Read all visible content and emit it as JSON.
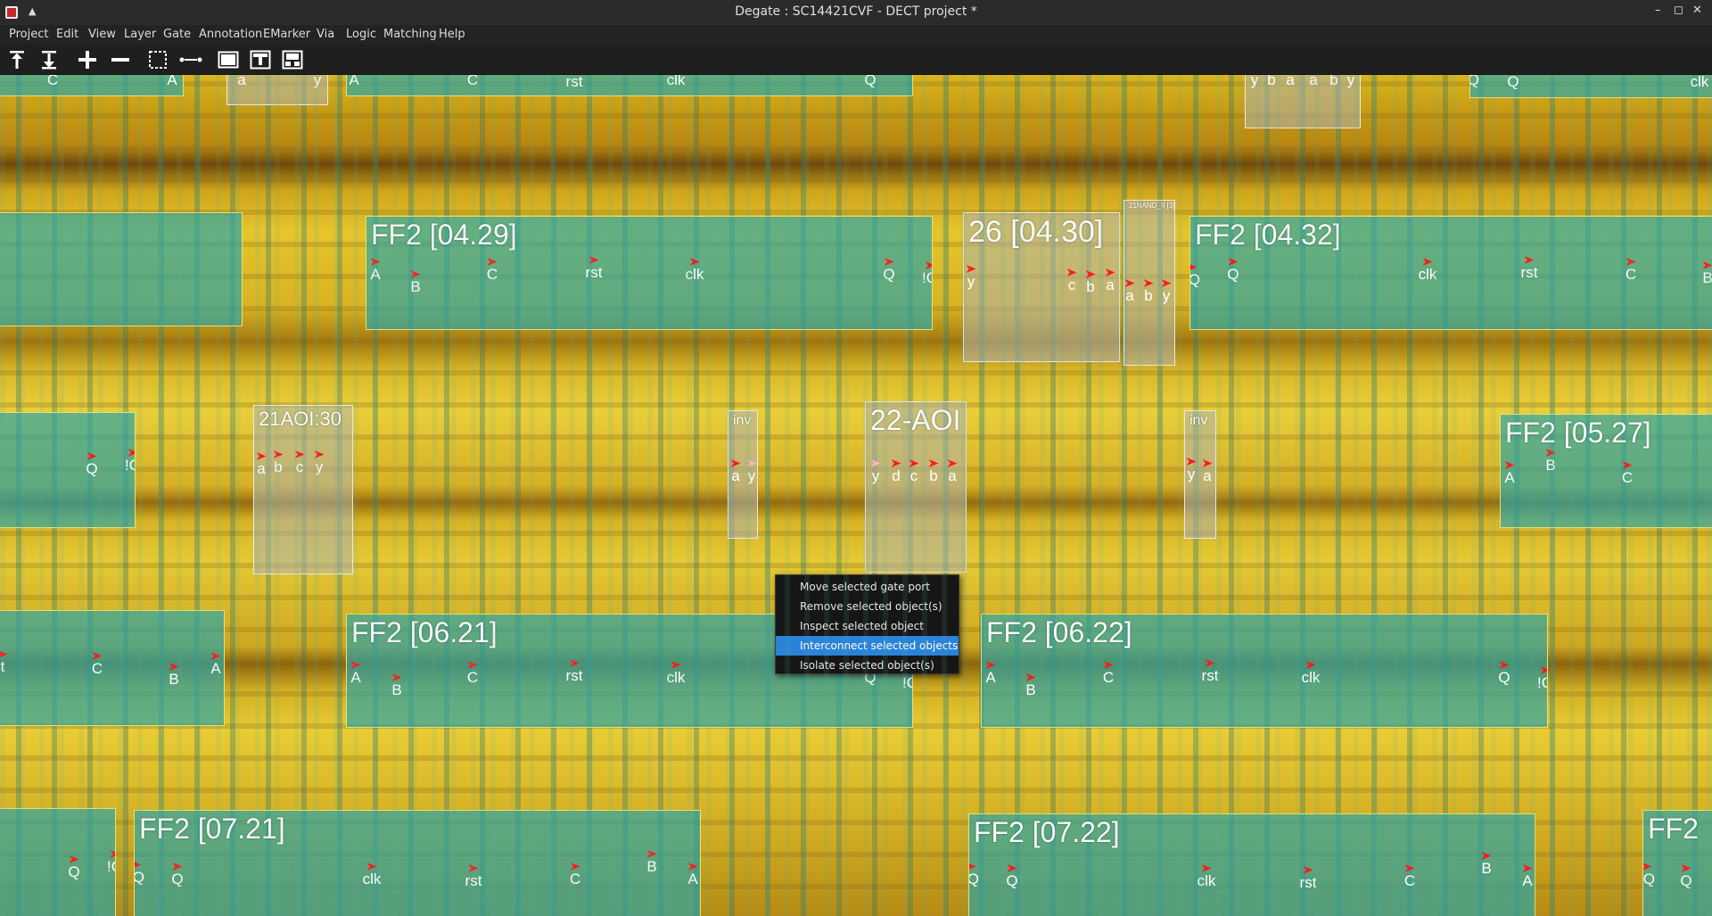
{
  "window": {
    "title": "Degate : SC14421CVF - DECT project *",
    "controls": [
      "–",
      "◻",
      "✕"
    ]
  },
  "menu": [
    "Project",
    "Edit",
    "View",
    "Layer",
    "Gate",
    "Annotation",
    "EMarker",
    "Via",
    "Logic",
    "Matching",
    "Help"
  ],
  "toolbar": [
    {
      "icon": "layer-up-icon"
    },
    {
      "icon": "layer-down-icon"
    },
    {
      "icon": "zoom-in-icon"
    },
    {
      "icon": "zoom-out-icon"
    },
    {
      "icon": "area-select-icon"
    },
    {
      "icon": "wire-tool-icon"
    },
    {
      "icon": "background-view-icon"
    },
    {
      "icon": "gate-template-icon"
    },
    {
      "icon": "gate-placement-icon"
    }
  ],
  "gates": [
    {
      "label": "",
      "style": "teal",
      "ports": [
        {
          "name": "C"
        },
        {
          "name": "A"
        }
      ]
    },
    {
      "label": "",
      "style": "gray",
      "ports": [
        {
          "name": "a"
        },
        {
          "name": "y"
        }
      ]
    },
    {
      "label": "",
      "style": "teal",
      "ports": [
        {
          "name": "A"
        },
        {
          "name": "C"
        },
        {
          "name": "rst"
        },
        {
          "name": "clk"
        },
        {
          "name": "Q"
        }
      ]
    },
    {
      "label": "",
      "style": "gray",
      "ports": [
        {
          "name": "y"
        },
        {
          "name": "b"
        },
        {
          "name": "a"
        },
        {
          "name": "a"
        },
        {
          "name": "b"
        },
        {
          "name": "y"
        }
      ]
    },
    {
      "label": "",
      "style": "teal",
      "ports": [
        {
          "name": "!Q"
        },
        {
          "name": "Q"
        },
        {
          "name": "clk"
        }
      ]
    },
    {
      "label": "",
      "style": "teal",
      "ports": []
    },
    {
      "label": "FF2 [04.29]",
      "style": "teal",
      "ports": [
        {
          "name": "A"
        },
        {
          "name": "B"
        },
        {
          "name": "C"
        },
        {
          "name": "rst"
        },
        {
          "name": "clk"
        },
        {
          "name": "Q"
        },
        {
          "name": "!Q"
        }
      ]
    },
    {
      "label": "26 [04.30]",
      "style": "gray",
      "ports": [
        {
          "name": "y"
        },
        {
          "name": "c"
        },
        {
          "name": "b"
        },
        {
          "name": "a"
        }
      ]
    },
    {
      "label": "21NAND_II [3]",
      "style": "gray",
      "ports": [
        {
          "name": "a"
        },
        {
          "name": "b"
        },
        {
          "name": "y"
        }
      ]
    },
    {
      "label": "FF2 [04.32]",
      "style": "teal",
      "ports": [
        {
          "name": "!Q"
        },
        {
          "name": "Q"
        },
        {
          "name": "clk"
        },
        {
          "name": "rst"
        },
        {
          "name": "C"
        },
        {
          "name": "B"
        }
      ]
    },
    {
      "label": "",
      "style": "teal",
      "ports": [
        {
          "name": "Q"
        },
        {
          "name": "!Q"
        }
      ]
    },
    {
      "label": "21AOI:30",
      "style": "gray",
      "ports": [
        {
          "name": "a"
        },
        {
          "name": "b"
        },
        {
          "name": "c"
        },
        {
          "name": "y"
        }
      ]
    },
    {
      "label": "inv",
      "style": "gray",
      "ports": [
        {
          "name": "a"
        },
        {
          "name": "y"
        }
      ]
    },
    {
      "label": "22-AOI",
      "style": "gray",
      "ports": [
        {
          "name": "y"
        },
        {
          "name": "d"
        },
        {
          "name": "c"
        },
        {
          "name": "b"
        },
        {
          "name": "a"
        }
      ]
    },
    {
      "label": "inv",
      "style": "gray",
      "ports": [
        {
          "name": "y"
        },
        {
          "name": "a"
        }
      ]
    },
    {
      "label": "FF2 [05.27]",
      "style": "teal",
      "ports": [
        {
          "name": "A"
        },
        {
          "name": "B"
        },
        {
          "name": "C"
        }
      ]
    },
    {
      "label": "",
      "style": "teal",
      "ports": [
        {
          "name": "t"
        },
        {
          "name": "C"
        },
        {
          "name": "B"
        },
        {
          "name": "A"
        }
      ]
    },
    {
      "label": "FF2 [06.21]",
      "style": "teal",
      "ports": [
        {
          "name": "A"
        },
        {
          "name": "B"
        },
        {
          "name": "C"
        },
        {
          "name": "rst"
        },
        {
          "name": "clk"
        },
        {
          "name": "Q"
        },
        {
          "name": "!Q"
        }
      ]
    },
    {
      "label": "FF2 [06.22]",
      "style": "teal",
      "ports": [
        {
          "name": "A"
        },
        {
          "name": "B"
        },
        {
          "name": "C"
        },
        {
          "name": "rst"
        },
        {
          "name": "clk"
        },
        {
          "name": "Q"
        },
        {
          "name": "!Q"
        }
      ]
    },
    {
      "label": "",
      "style": "teal",
      "ports": [
        {
          "name": "Q"
        },
        {
          "name": "!Q"
        }
      ]
    },
    {
      "label": "FF2 [07.21]",
      "style": "teal",
      "ports": [
        {
          "name": "!Q"
        },
        {
          "name": "Q"
        },
        {
          "name": "clk"
        },
        {
          "name": "rst"
        },
        {
          "name": "C"
        },
        {
          "name": "B"
        },
        {
          "name": "A"
        }
      ]
    },
    {
      "label": "FF2 [07.22]",
      "style": "teal",
      "ports": [
        {
          "name": "!Q"
        },
        {
          "name": "Q"
        },
        {
          "name": "clk"
        },
        {
          "name": "rst"
        },
        {
          "name": "C"
        },
        {
          "name": "B"
        },
        {
          "name": "A"
        }
      ]
    },
    {
      "label": "FF2",
      "style": "teal",
      "ports": [
        {
          "name": "!Q"
        },
        {
          "name": "Q"
        }
      ]
    }
  ],
  "context_menu": {
    "items": [
      {
        "label": "Move selected gate port"
      },
      {
        "label": "Remove selected object(s)"
      },
      {
        "label": "Inspect selected object"
      },
      {
        "label": "Interconnect selected objects",
        "highlighted": true
      },
      {
        "label": "Isolate selected object(s)"
      }
    ]
  },
  "colors": {
    "selection_highlight": "#2a82da",
    "gate_fill": "#28a5aa",
    "port_marker": "#ff1a1a"
  }
}
